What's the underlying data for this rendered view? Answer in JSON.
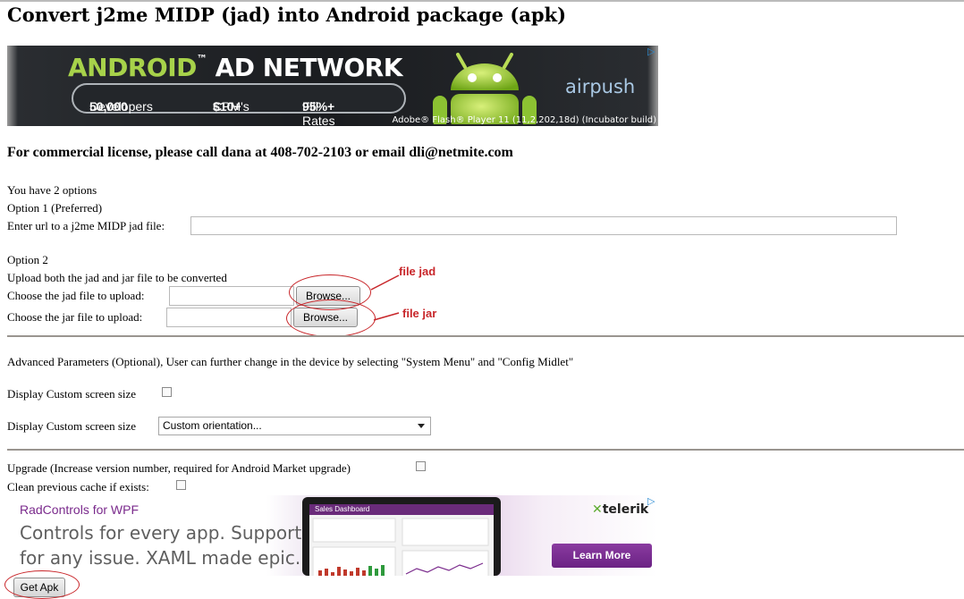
{
  "page": {
    "title": "Convert j2me MIDP (jad) into Android package (apk)",
    "license": "For commercial license, please call dana at 408-702-2103 or email dli@netmite.com"
  },
  "ad_top": {
    "headline_main": "ANDROID",
    "headline_tm": "™",
    "headline_rest": " AD NETWORK",
    "stat1_num": "50,000",
    "stat1_text": " Developers",
    "stat2_num": "$10+",
    "stat2_text": " CPM's",
    "stat3_num": "95%+",
    "stat3_text": " Fill Rates",
    "brand": "airpush",
    "flash_note": "Adobe® Flash® Player 11 (11,2,202,18d) (Incubator build)",
    "colors": {
      "green": "#a7d24a",
      "blue": "#a9c8e4"
    }
  },
  "options": {
    "intro": "You have 2 options",
    "option1_label": "Option 1 (Preferred)",
    "url_label": "Enter url to a j2me MIDP jad file:",
    "url_value": "",
    "option2_label": "Option 2",
    "upload_label": "Upload both the jad and jar file to be converted",
    "jad_label": "Choose the jad file to upload:",
    "jar_label": "Choose the jar file to upload:",
    "browse_label": "Browse..."
  },
  "annotations": {
    "file_jad": "file jad",
    "file_jar": "file jar",
    "color": "#c8262a"
  },
  "advanced": {
    "heading": "Advanced Parameters (Optional), User can further change in the device by selecting \"System Menu\" and \"Config Midlet\"",
    "custom_size_label": "Display Custom screen size",
    "custom_size_checked": false,
    "orientation_label": "Display Custom screen size",
    "orientation_value": "Custom orientation..."
  },
  "upgrade": {
    "upgrade_label": "Upgrade (Increase version number, required for Android Market upgrade)",
    "upgrade_checked": false,
    "cache_label": "Clean previous cache if exists:",
    "cache_checked": false
  },
  "ad_bottom": {
    "product": "RadControls for WPF",
    "line1": "Controls for every app. Support",
    "line2": "for any issue. XAML made epic.",
    "dashboard_title": "Sales Dashboard",
    "brand": "telerik",
    "cta": "Learn More",
    "colors": {
      "purple": "#6b2284"
    }
  },
  "submit": {
    "label": "Get Apk"
  }
}
